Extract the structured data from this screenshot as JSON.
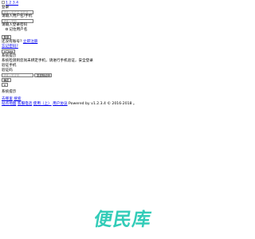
{
  "header": {
    "logo_alt": "1.2.3.4"
  },
  "login": {
    "title": "登录",
    "username_placeholder": "请输入用户名/手机号",
    "password_label": "请输入用户名/手机",
    "password_placeholder": "请输入密码",
    "verify_label": "请输入登录密码",
    "remember_label": "记住用户名",
    "submit_label": "登录",
    "no_account_text": "还没有账号?",
    "register_link": "立即注册",
    "forgot_link": "忘记密码?",
    "close_button": "×Close"
  },
  "system_tip": {
    "title": "系统提示",
    "message": "系统检测到您尚未绑定手机，请进行手机验证，安全登录",
    "phone_label": "验证手机",
    "code_label": "验证码",
    "code_placeholder": "请输入验证码",
    "send_code_button": "发送验证码",
    "confirm_button": "确定",
    "small_button": "×"
  },
  "second_tip": {
    "title": "系统提示"
  },
  "footer": {
    "line1": [
      "去哪里",
      "搜索"
    ],
    "line2_links": [
      "站点地图",
      "客服电话",
      "使用（上）",
      "用户协议"
    ],
    "powered": "Powered by ",
    "version": "v1.2.3.4 © 2016-2018 。"
  },
  "brand": {
    "text": "便民库",
    "color": "#33ccb8"
  }
}
